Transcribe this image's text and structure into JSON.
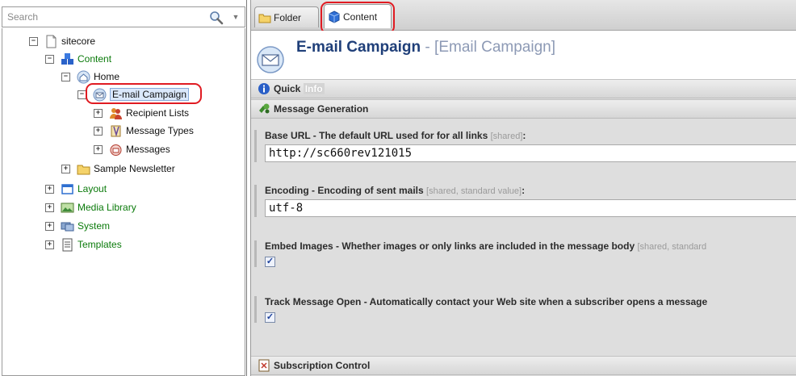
{
  "search": {
    "placeholder": "Search"
  },
  "tree": {
    "root": "sitecore",
    "content": "Content",
    "home": "Home",
    "email_campaign": "E-mail Campaign",
    "recipient_lists": "Recipient Lists",
    "message_types": "Message Types",
    "messages": "Messages",
    "sample_newsletter": "Sample Newsletter",
    "layout": "Layout",
    "media_library": "Media Library",
    "system": "System",
    "templates": "Templates"
  },
  "tabs": {
    "folder": "Folder",
    "content": "Content"
  },
  "header": {
    "title": "E-mail Campaign",
    "subtitle": " - [Email Campaign]"
  },
  "sections": {
    "quick": "Quick",
    "quick_info": "Info",
    "message_generation": "Message Generation",
    "subscription_control": "Subscription Control"
  },
  "fields": {
    "base_url": {
      "label": "Base URL - The default URL used for for all links",
      "meta": "[shared]",
      "suffix": ":",
      "value": "http://sc660rev121015"
    },
    "encoding": {
      "label": "Encoding - Encoding of sent mails",
      "meta": "[shared, standard value]",
      "suffix": ":",
      "value": "utf-8"
    },
    "embed_images": {
      "label": "Embed Images - Whether images or only links are included in the message body",
      "meta": "[shared, standard",
      "checked": "✓"
    },
    "track_open": {
      "label": "Track Message Open - Automatically contact your Web site when a subscriber opens a message",
      "checked": "✓"
    }
  }
}
